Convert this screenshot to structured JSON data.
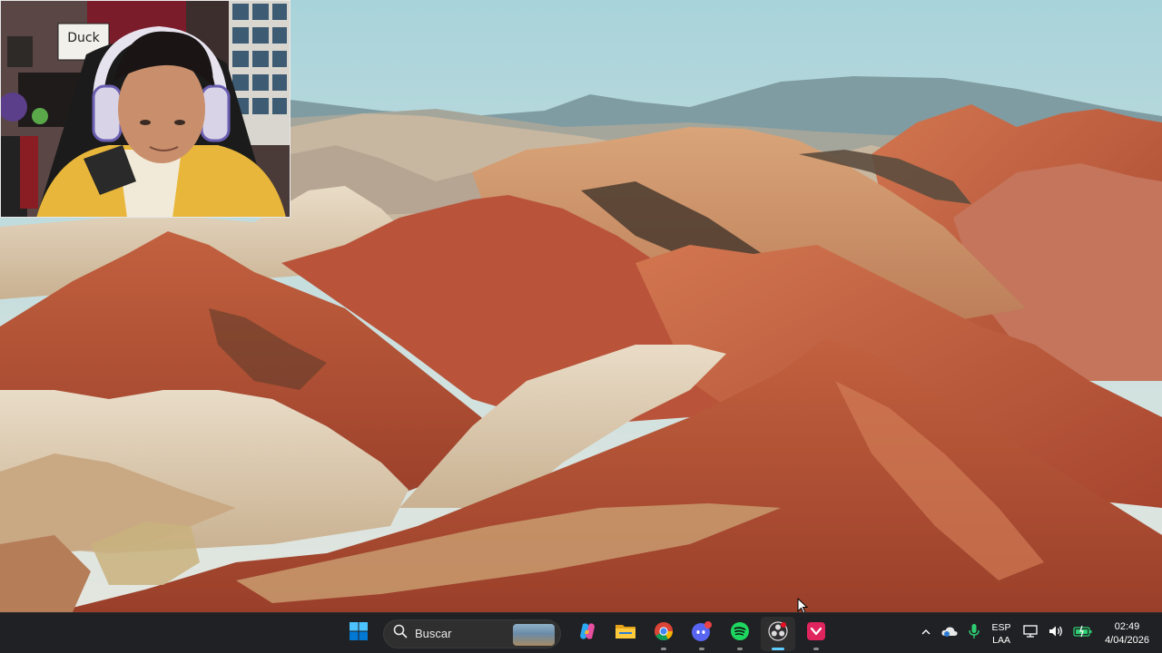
{
  "taskbar": {
    "search": {
      "label": "Buscar"
    },
    "apps": [
      {
        "name": "Windows Start",
        "icon": "windows-logo-icon"
      },
      {
        "name": "Search",
        "icon": "search-icon"
      },
      {
        "name": "Copilot",
        "icon": "copilot-icon"
      },
      {
        "name": "File Explorer",
        "icon": "folder-icon"
      },
      {
        "name": "Google Chrome",
        "icon": "chrome-icon"
      },
      {
        "name": "Discord",
        "icon": "discord-icon"
      },
      {
        "name": "Spotify",
        "icon": "spotify-icon"
      },
      {
        "name": "OBS",
        "icon": "obs-icon",
        "active": true
      },
      {
        "name": "Red app",
        "icon": "red-app-icon"
      }
    ],
    "tray": {
      "language_top": "ESP",
      "language_bottom": "LAA",
      "time": "02:49",
      "date": "4/04/2026"
    }
  },
  "webcam": {
    "sign_text": "Duck"
  },
  "colors": {
    "taskbar_bg": "#202124",
    "accent": "#60cdff",
    "sky_top": "#a8d0d8",
    "sky_bottom": "#d8e3e0",
    "rock_red": "#b5523a",
    "rock_cream": "#e0cfb6"
  }
}
